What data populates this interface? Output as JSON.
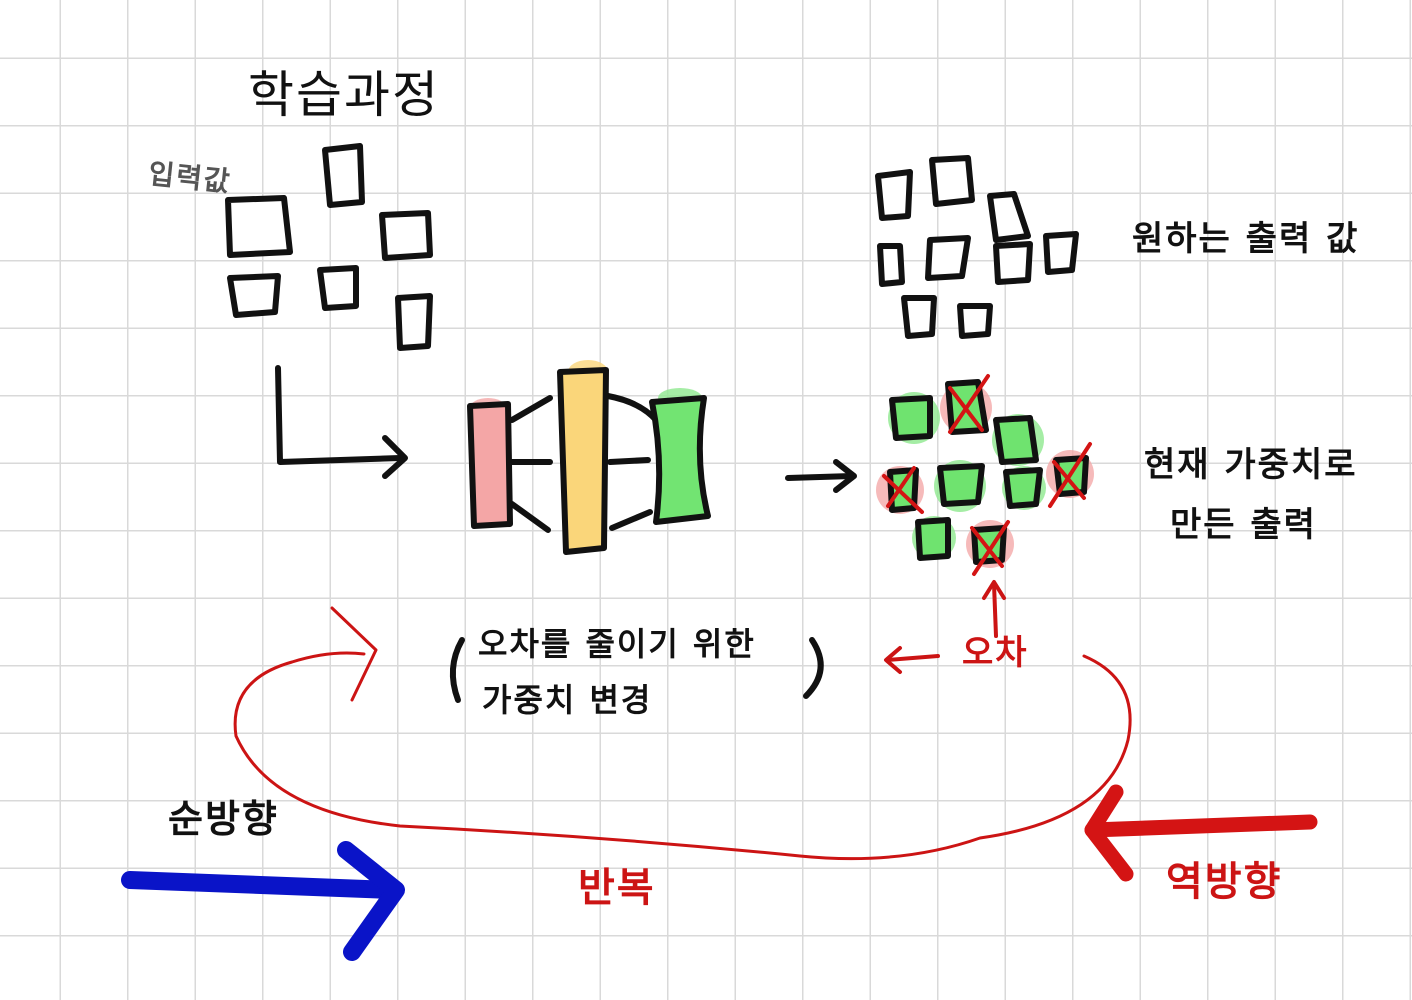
{
  "title": "학습과정",
  "labels": {
    "input": "입력값",
    "desired_output": "원하는 출력 값",
    "current_output_line1": "현재 가중치로",
    "current_output_line2": "만든 출력",
    "update_line1": "오차를 줄이기 위한",
    "update_line2": "가중치 변경",
    "error": "오차",
    "forward": "순방향",
    "repeat": "반복",
    "backward": "역방향"
  },
  "colors": {
    "ink": "#111111",
    "error_red": "#cc1414",
    "forward_blue": "#0a14c8",
    "layer_input": "#f4a6a6",
    "layer_hidden": "#fad67a",
    "layer_output": "#72e472",
    "glow_green": "#8ee88e",
    "glow_red": "#f3a3a3"
  }
}
